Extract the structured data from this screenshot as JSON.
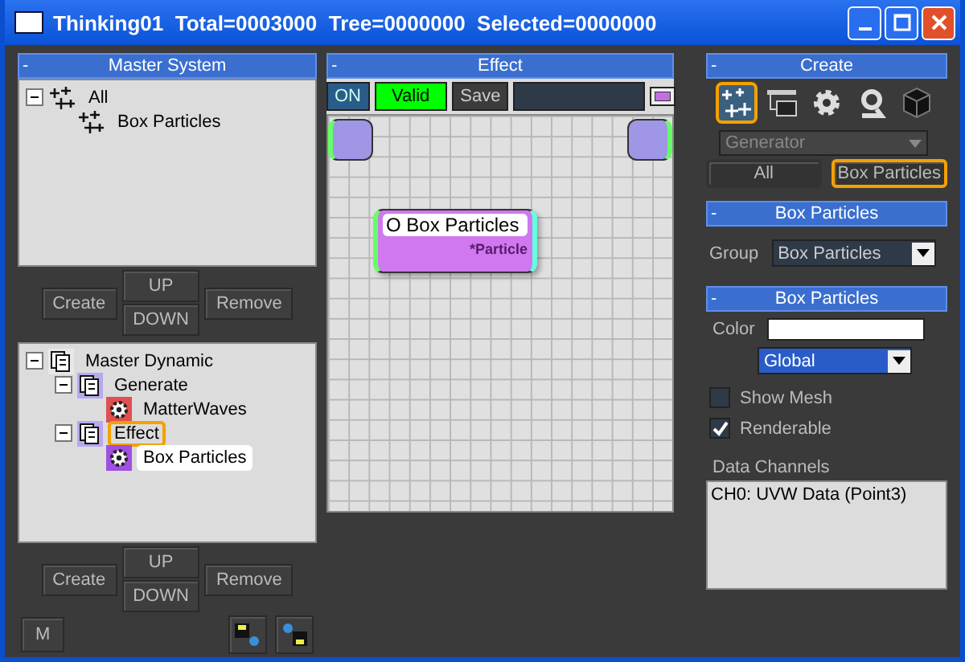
{
  "window": {
    "title": "Thinking01  Total=0003000  Tree=0000000  Selected=0000000"
  },
  "master_system": {
    "collapse": "-",
    "title": "Master System",
    "tree": [
      {
        "label": "All",
        "kind": "system",
        "expanded": true,
        "selected": false,
        "highlighted": false,
        "children": [
          {
            "label": "Box Particles",
            "kind": "system",
            "selected": false,
            "highlighted": false
          }
        ]
      }
    ],
    "buttons": {
      "create": "Create",
      "up": "UP",
      "down": "DOWN",
      "remove": "Remove"
    }
  },
  "master_dynamic": {
    "tree": [
      {
        "label": "Master Dynamic",
        "kind": "group",
        "expanded": true,
        "selected": false,
        "highlighted": false,
        "children": [
          {
            "label": "Generate",
            "kind": "group",
            "expanded": true,
            "selected": false,
            "highlighted": false,
            "children": [
              {
                "label": "MatterWaves",
                "kind": "operator",
                "color": "#e05050",
                "selected": false,
                "highlighted": false
              }
            ]
          },
          {
            "label": "Effect",
            "kind": "group",
            "expanded": true,
            "selected": false,
            "highlighted": true,
            "children": [
              {
                "label": "Box Particles",
                "kind": "operator",
                "color": "#a050e0",
                "selected": true,
                "highlighted": false
              }
            ]
          }
        ]
      }
    ],
    "buttons": {
      "create": "Create",
      "up": "UP",
      "down": "DOWN",
      "remove": "Remove",
      "m": "M"
    }
  },
  "effect": {
    "collapse": "-",
    "title": "Effect",
    "on": "ON",
    "valid": "Valid",
    "save": "Save",
    "node": {
      "title": "O Box Particles",
      "subtitle": "*Particle"
    }
  },
  "create": {
    "collapse": "-",
    "title": "Create",
    "tools": [
      {
        "kind": "particles",
        "selected": true
      },
      {
        "kind": "list",
        "selected": false
      },
      {
        "kind": "gear",
        "selected": false
      },
      {
        "kind": "hook",
        "selected": false
      },
      {
        "kind": "cube",
        "selected": false
      }
    ],
    "category": {
      "value": "Generator",
      "disabled": true
    },
    "filters": [
      {
        "label": "All",
        "selected": false
      },
      {
        "label": "Box Particles",
        "selected": true
      }
    ]
  },
  "group_panel": {
    "collapse": "-",
    "title": "Box Particles",
    "label": "Group",
    "value": "Box Particles"
  },
  "props_panel": {
    "collapse": "-",
    "title": "Box Particles",
    "color_label": "Color",
    "mode": "Global",
    "checkboxes": [
      {
        "label": "Show Mesh",
        "checked": false
      },
      {
        "label": "Renderable",
        "checked": true
      }
    ],
    "channels_label": "Data Channels",
    "channels": [
      "CH0: UVW Data (Point3)"
    ]
  }
}
